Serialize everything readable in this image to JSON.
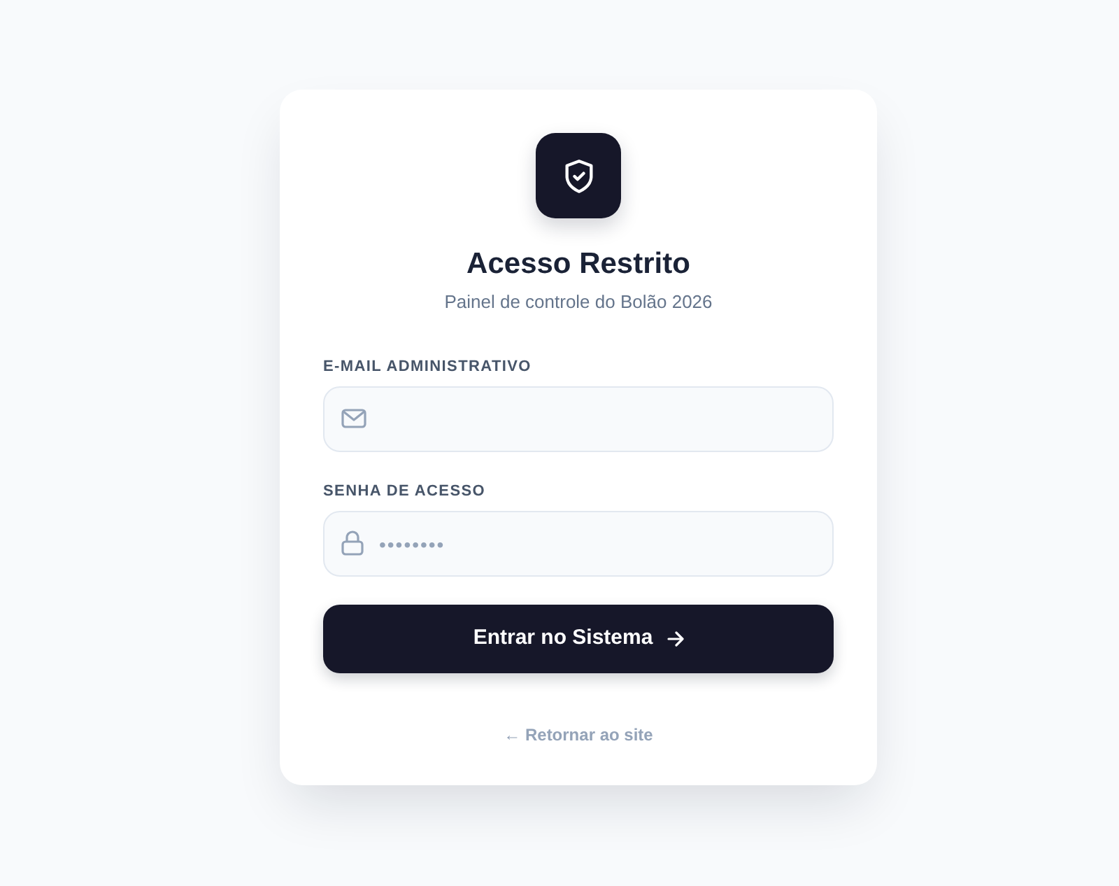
{
  "card": {
    "title": "Acesso Restrito",
    "subtitle": "Painel de controle do Bolão 2026"
  },
  "fields": [
    {
      "label": "E-MAIL ADMINISTRATIVO",
      "kind": "email"
    },
    {
      "label": "SENHA DE ACESSO",
      "kind": "password",
      "placeholder": "••••••••"
    }
  ],
  "submit_button": {
    "label": "Entrar no Sistema"
  },
  "back_link": {
    "label": "← Retornar ao site"
  }
}
